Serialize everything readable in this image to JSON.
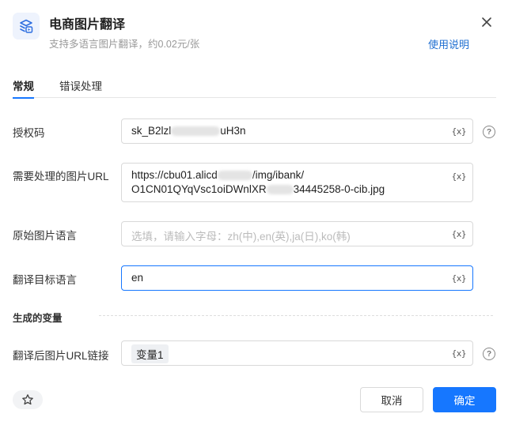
{
  "header": {
    "icon": "translate-image-icon",
    "title": "电商图片翻译",
    "subtitle": "支持多语言图片翻译，约0.02元/张",
    "help_link": "使用说明",
    "close_icon": "close-icon"
  },
  "tabs": [
    {
      "label": "常规",
      "active": true
    },
    {
      "label": "错误处理",
      "active": false
    }
  ],
  "fields": {
    "auth_code": {
      "label": "授权码",
      "value_prefix": "sk_B2lzl",
      "value_suffix": "uH3n"
    },
    "image_url": {
      "label": "需要处理的图片URL",
      "line1_prefix": "https://cbu01.alicd",
      "line1_suffix": "/img/ibank/",
      "line2_prefix": "O1CN01QYqVsc1oiDWnlXR",
      "line2_suffix": "34445258-0-cib.jpg"
    },
    "source_lang": {
      "label": "原始图片语言",
      "placeholder": "选填，请输入字母：zh(中),en(英),ja(日),ko(韩)"
    },
    "target_lang": {
      "label": "翻译目标语言",
      "value": "en"
    }
  },
  "output": {
    "section_title": "生成的变量",
    "result_label": "翻译后图片URL链接",
    "variable_tag": "变量1"
  },
  "variable_button": "{x}",
  "help_mark": "?",
  "footer": {
    "cancel_label": "取消",
    "confirm_label": "确定",
    "star_icon": "star-icon"
  },
  "colors": {
    "accent": "#1677ff",
    "link": "#1f6fd1",
    "border": "#d9d9d9"
  }
}
